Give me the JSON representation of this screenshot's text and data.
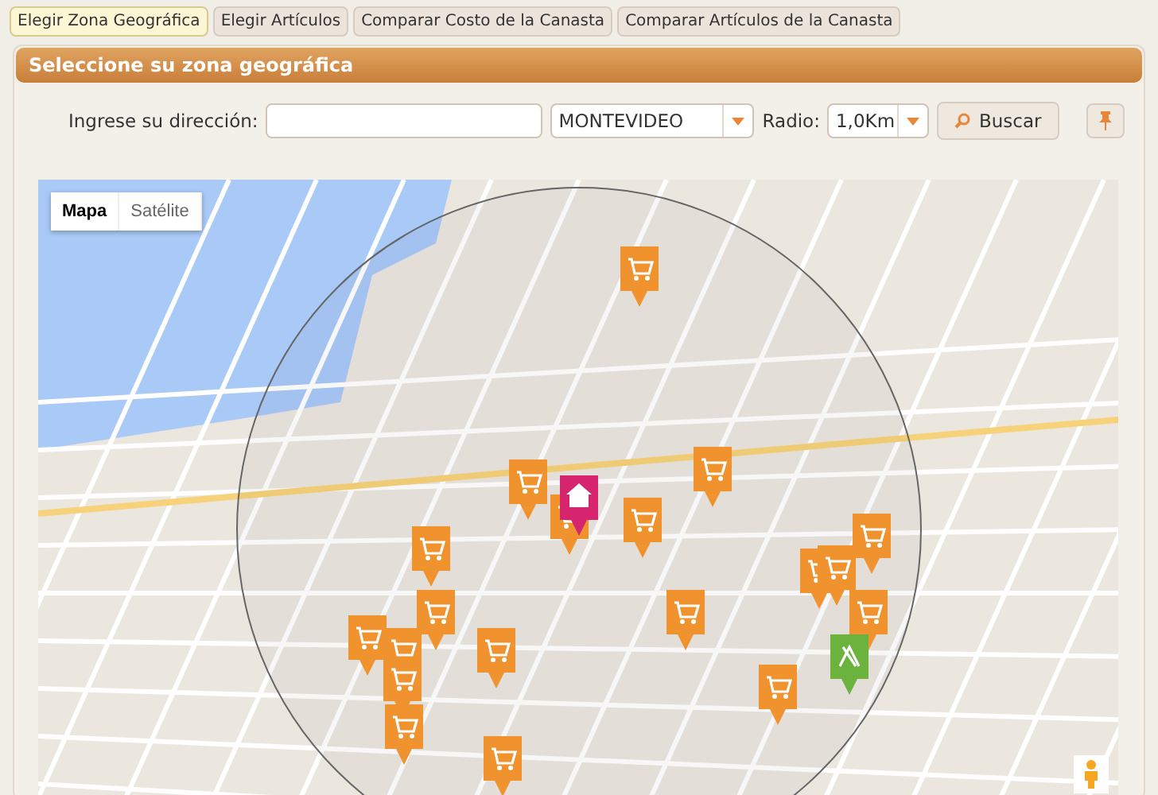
{
  "tabs": [
    {
      "label": "Elegir Zona Geográfica",
      "selected": true
    },
    {
      "label": "Elegir Artículos",
      "selected": false
    },
    {
      "label": "Comparar Costo de la Canasta",
      "selected": false
    },
    {
      "label": "Comparar Artículos de la Canasta",
      "selected": false
    }
  ],
  "panel": {
    "title": "Seleccione su zona geográfica"
  },
  "form": {
    "address_label": "Ingrese su dirección:",
    "city": "MONTEVIDEO",
    "radius_label": "Radio:",
    "radius": "1,0Km",
    "search_button": "Buscar"
  },
  "map": {
    "types": [
      {
        "label": "Mapa",
        "selected": true
      },
      {
        "label": "Satélite",
        "selected": false
      }
    ]
  }
}
